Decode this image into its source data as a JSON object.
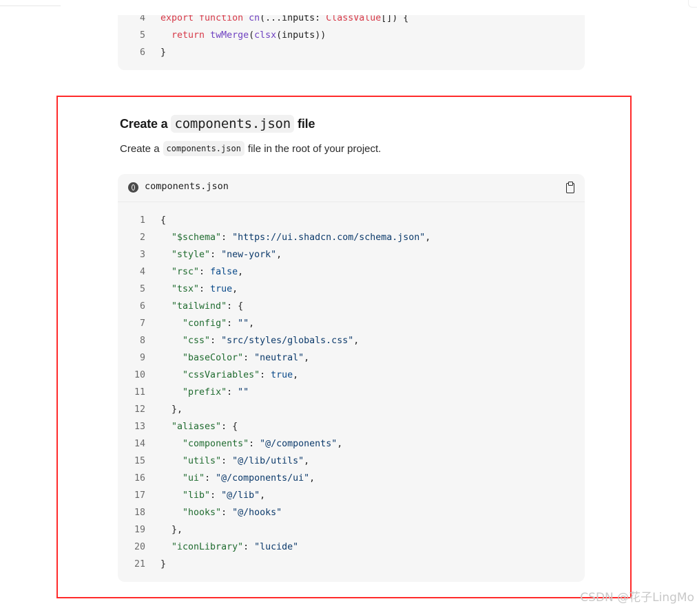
{
  "prev_code": [
    {
      "n": "4",
      "tokens": [
        [
          "tok-kw",
          "export "
        ],
        [
          "tok-kw",
          "function "
        ],
        [
          "tok-fn",
          "cn"
        ],
        [
          "tok-plain",
          "(...inputs: "
        ],
        [
          "tok-kw",
          "ClassValue"
        ],
        [
          "tok-plain",
          "[]) {"
        ]
      ]
    },
    {
      "n": "5",
      "tokens": [
        [
          "tok-plain",
          "  "
        ],
        [
          "tok-kw",
          "return "
        ],
        [
          "tok-fn",
          "twMerge"
        ],
        [
          "tok-plain",
          "("
        ],
        [
          "tok-fn",
          "clsx"
        ],
        [
          "tok-plain",
          "(inputs))"
        ]
      ]
    },
    {
      "n": "6",
      "tokens": [
        [
          "tok-plain",
          "}"
        ]
      ]
    }
  ],
  "section": {
    "title_prefix": "Create a",
    "title_code": "components.json",
    "title_suffix": "file",
    "desc_prefix": "Create a",
    "desc_code": "components.json",
    "desc_suffix": "file in the root of your project."
  },
  "code_block": {
    "filename": "components.json",
    "lines": [
      {
        "n": "1",
        "tokens": [
          [
            "tok-punct",
            "{"
          ]
        ]
      },
      {
        "n": "2",
        "tokens": [
          [
            "tok-plain",
            "  "
          ],
          [
            "tok-key",
            "\"$schema\""
          ],
          [
            "tok-punct",
            ": "
          ],
          [
            "tok-str",
            "\"https://ui.shadcn.com/schema.json\""
          ],
          [
            "tok-punct",
            ","
          ]
        ]
      },
      {
        "n": "3",
        "tokens": [
          [
            "tok-plain",
            "  "
          ],
          [
            "tok-key",
            "\"style\""
          ],
          [
            "tok-punct",
            ": "
          ],
          [
            "tok-str",
            "\"new-york\""
          ],
          [
            "tok-punct",
            ","
          ]
        ]
      },
      {
        "n": "4",
        "tokens": [
          [
            "tok-plain",
            "  "
          ],
          [
            "tok-key",
            "\"rsc\""
          ],
          [
            "tok-punct",
            ": "
          ],
          [
            "tok-lit",
            "false"
          ],
          [
            "tok-punct",
            ","
          ]
        ]
      },
      {
        "n": "5",
        "tokens": [
          [
            "tok-plain",
            "  "
          ],
          [
            "tok-key",
            "\"tsx\""
          ],
          [
            "tok-punct",
            ": "
          ],
          [
            "tok-lit",
            "true"
          ],
          [
            "tok-punct",
            ","
          ]
        ]
      },
      {
        "n": "6",
        "tokens": [
          [
            "tok-plain",
            "  "
          ],
          [
            "tok-key",
            "\"tailwind\""
          ],
          [
            "tok-punct",
            ": {"
          ]
        ]
      },
      {
        "n": "7",
        "tokens": [
          [
            "tok-plain",
            "    "
          ],
          [
            "tok-key",
            "\"config\""
          ],
          [
            "tok-punct",
            ": "
          ],
          [
            "tok-str",
            "\"\""
          ],
          [
            "tok-punct",
            ","
          ]
        ]
      },
      {
        "n": "8",
        "tokens": [
          [
            "tok-plain",
            "    "
          ],
          [
            "tok-key",
            "\"css\""
          ],
          [
            "tok-punct",
            ": "
          ],
          [
            "tok-str",
            "\"src/styles/globals.css\""
          ],
          [
            "tok-punct",
            ","
          ]
        ]
      },
      {
        "n": "9",
        "tokens": [
          [
            "tok-plain",
            "    "
          ],
          [
            "tok-key",
            "\"baseColor\""
          ],
          [
            "tok-punct",
            ": "
          ],
          [
            "tok-str",
            "\"neutral\""
          ],
          [
            "tok-punct",
            ","
          ]
        ]
      },
      {
        "n": "10",
        "tokens": [
          [
            "tok-plain",
            "    "
          ],
          [
            "tok-key",
            "\"cssVariables\""
          ],
          [
            "tok-punct",
            ": "
          ],
          [
            "tok-lit",
            "true"
          ],
          [
            "tok-punct",
            ","
          ]
        ]
      },
      {
        "n": "11",
        "tokens": [
          [
            "tok-plain",
            "    "
          ],
          [
            "tok-key",
            "\"prefix\""
          ],
          [
            "tok-punct",
            ": "
          ],
          [
            "tok-str",
            "\"\""
          ]
        ]
      },
      {
        "n": "12",
        "tokens": [
          [
            "tok-plain",
            "  "
          ],
          [
            "tok-punct",
            "},"
          ]
        ]
      },
      {
        "n": "13",
        "tokens": [
          [
            "tok-plain",
            "  "
          ],
          [
            "tok-key",
            "\"aliases\""
          ],
          [
            "tok-punct",
            ": {"
          ]
        ]
      },
      {
        "n": "14",
        "tokens": [
          [
            "tok-plain",
            "    "
          ],
          [
            "tok-key",
            "\"components\""
          ],
          [
            "tok-punct",
            ": "
          ],
          [
            "tok-str",
            "\"@/components\""
          ],
          [
            "tok-punct",
            ","
          ]
        ]
      },
      {
        "n": "15",
        "tokens": [
          [
            "tok-plain",
            "    "
          ],
          [
            "tok-key",
            "\"utils\""
          ],
          [
            "tok-punct",
            ": "
          ],
          [
            "tok-str",
            "\"@/lib/utils\""
          ],
          [
            "tok-punct",
            ","
          ]
        ]
      },
      {
        "n": "16",
        "tokens": [
          [
            "tok-plain",
            "    "
          ],
          [
            "tok-key",
            "\"ui\""
          ],
          [
            "tok-punct",
            ": "
          ],
          [
            "tok-str",
            "\"@/components/ui\""
          ],
          [
            "tok-punct",
            ","
          ]
        ]
      },
      {
        "n": "17",
        "tokens": [
          [
            "tok-plain",
            "    "
          ],
          [
            "tok-key",
            "\"lib\""
          ],
          [
            "tok-punct",
            ": "
          ],
          [
            "tok-str",
            "\"@/lib\""
          ],
          [
            "tok-punct",
            ","
          ]
        ]
      },
      {
        "n": "18",
        "tokens": [
          [
            "tok-plain",
            "    "
          ],
          [
            "tok-key",
            "\"hooks\""
          ],
          [
            "tok-punct",
            ": "
          ],
          [
            "tok-str",
            "\"@/hooks\""
          ]
        ]
      },
      {
        "n": "19",
        "tokens": [
          [
            "tok-plain",
            "  "
          ],
          [
            "tok-punct",
            "},"
          ]
        ]
      },
      {
        "n": "20",
        "tokens": [
          [
            "tok-plain",
            "  "
          ],
          [
            "tok-key",
            "\"iconLibrary\""
          ],
          [
            "tok-punct",
            ": "
          ],
          [
            "tok-str",
            "\"lucide\""
          ]
        ]
      },
      {
        "n": "21",
        "tokens": [
          [
            "tok-punct",
            "}"
          ]
        ]
      }
    ]
  },
  "watermark": "CSDN @花子LingMo",
  "colors": {
    "highlight_border": "#ff2a2a",
    "code_bg": "#f6f6f6",
    "string": "#0c3a6b",
    "key": "#1f6b2f",
    "keyword": "#d73a49"
  },
  "icons": {
    "file_icon": "json-file-icon",
    "copy_icon": "clipboard-copy-icon"
  }
}
